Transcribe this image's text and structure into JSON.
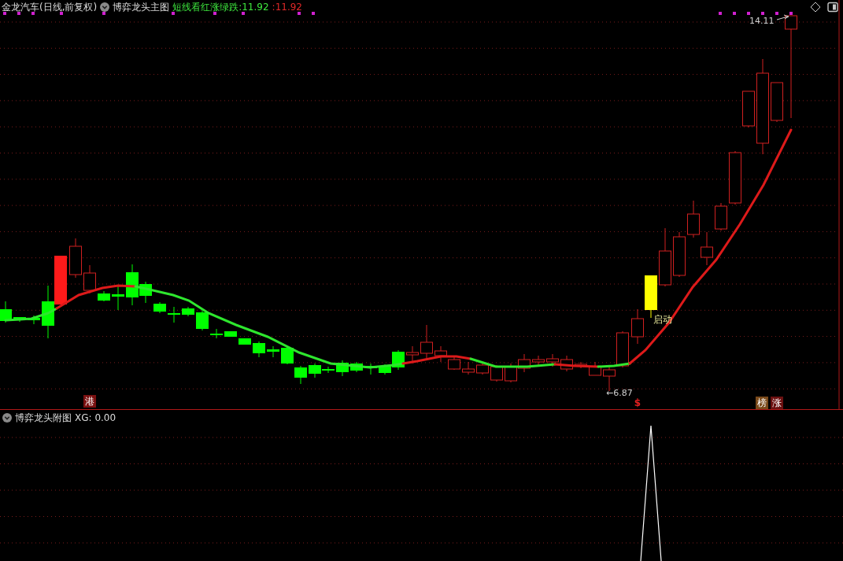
{
  "main_pane": {
    "security": "金龙汽车(日线,前复权)",
    "indicator": "博弈龙头主图",
    "legend": [
      {
        "text": "短线看红涨绿跌:11.92",
        "color": "#3ee83e"
      },
      {
        "text": ":11.92",
        "color": "#e02828"
      }
    ],
    "price_labels": [
      {
        "kind": "high",
        "text": "14.11"
      },
      {
        "kind": "low",
        "text": "←6.87"
      }
    ],
    "signals": [
      {
        "kind": "label",
        "text": "启动"
      },
      {
        "kind": "tag",
        "text": "港",
        "color": "#7a1010"
      },
      {
        "kind": "symbol",
        "text": "$"
      },
      {
        "kind": "tag",
        "text": "榜",
        "color": "#7a4a1a"
      },
      {
        "kind": "tag",
        "text": "涨",
        "color": "#6a1010"
      }
    ]
  },
  "sub_pane": {
    "indicator": "博弈龙头附图",
    "readout": "XG: 0.00"
  }
}
